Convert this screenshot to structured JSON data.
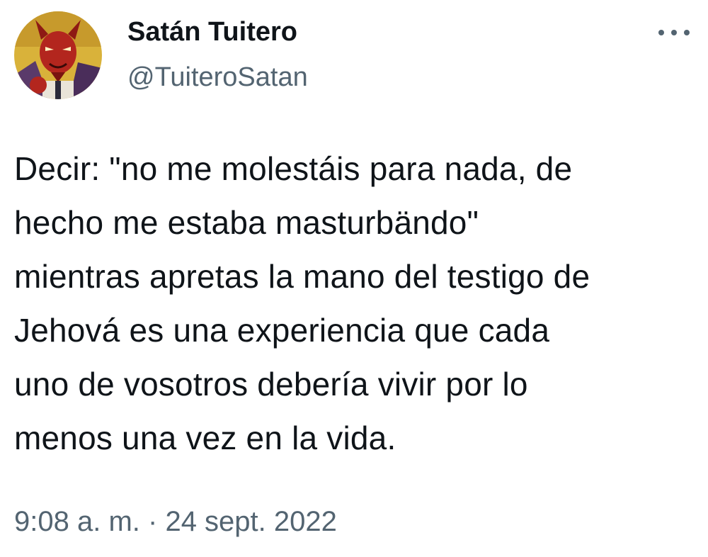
{
  "author": {
    "display_name": "Satán Tuitero",
    "handle": "@TuiteroSatan",
    "avatar_icon": "devil-avatar"
  },
  "more_icon": "more-options-icon",
  "tweet": {
    "text": "Decir: \"no me molestáis para nada, de\nhecho me estaba masturbändo\"\nmientras apretas la mano del testigo de\nJehová es una experiencia que cada\nuno de vosotros debería vivir por lo\nmenos una vez en la vida."
  },
  "meta": {
    "time": "9:08 a. m.",
    "separator": "·",
    "date": "24 sept. 2022"
  },
  "colors": {
    "text": "#0f1419",
    "secondary": "#536471",
    "background": "#ffffff"
  }
}
